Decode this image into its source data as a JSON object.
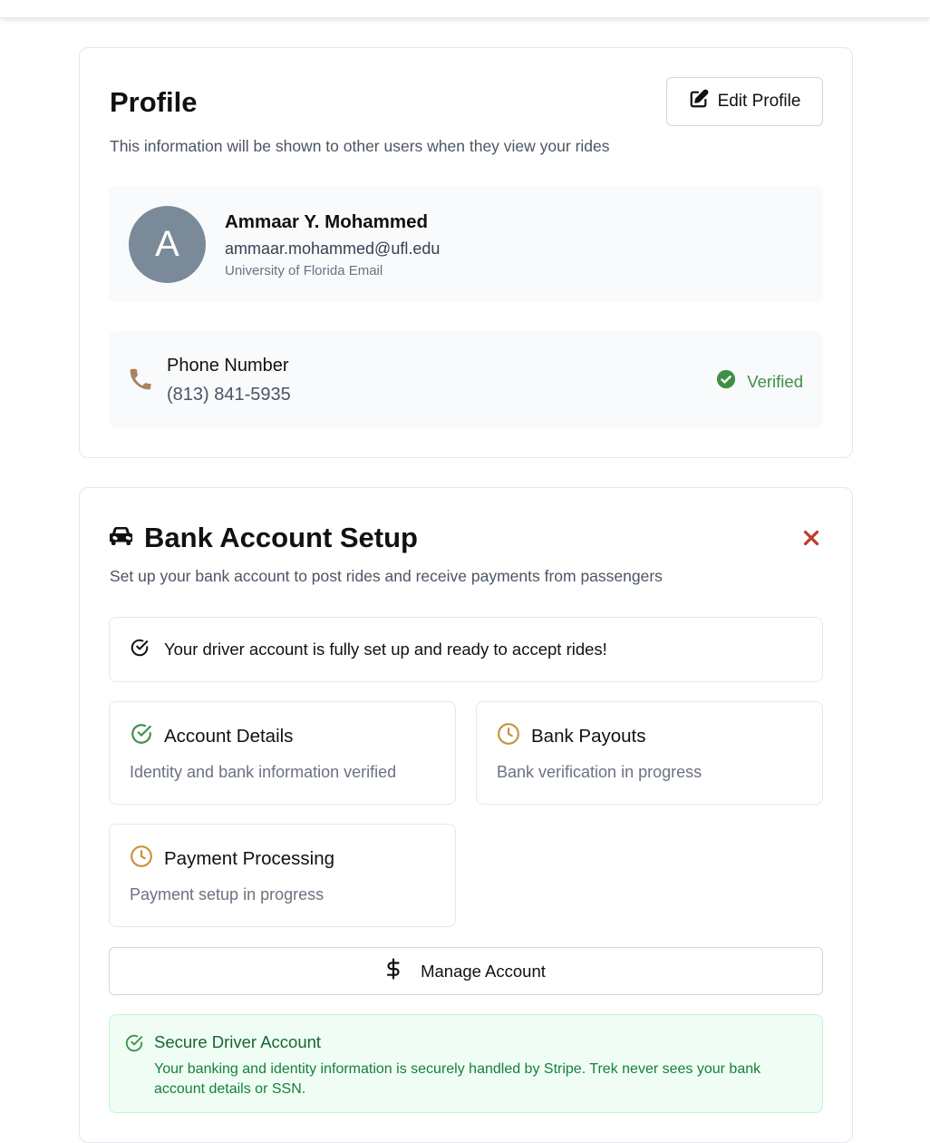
{
  "profile": {
    "title": "Profile",
    "edit_button_label": "Edit Profile",
    "subtitle": "This information will be shown to other users when they view your rides",
    "user": {
      "avatar_initial": "A",
      "name": "Ammaar Y. Mohammed",
      "email": "ammaar.mohammed@ufl.edu",
      "email_label": "University of Florida Email"
    },
    "phone": {
      "label": "Phone Number",
      "value": "(813) 841-5935",
      "status": "Verified"
    }
  },
  "bank": {
    "title": "Bank Account Setup",
    "subtitle": "Set up your bank account to post rides and receive payments from passengers",
    "status_message": "Your driver account is fully set up and ready to accept rides!",
    "tiles": [
      {
        "title": "Account Details",
        "description": "Identity and bank information verified",
        "icon": "check-circle-icon",
        "status": "complete"
      },
      {
        "title": "Bank Payouts",
        "description": "Bank verification in progress",
        "icon": "clock-icon",
        "status": "pending"
      },
      {
        "title": "Payment Processing",
        "description": "Payment setup in progress",
        "icon": "clock-icon",
        "status": "pending"
      }
    ],
    "manage_button_label": "Manage Account",
    "secure": {
      "title": "Secure Driver Account",
      "description": "Your banking and identity information is securely handled by Stripe. Trek never sees your bank account details or SSN."
    }
  },
  "colors": {
    "verified_green": "#3f8f46",
    "pending_amber": "#c8923c",
    "phone_icon_brown": "#a88462",
    "close_red": "#c0392b",
    "avatar_gray": "#7a8a98",
    "secure_bg": "#f0fdf4"
  }
}
